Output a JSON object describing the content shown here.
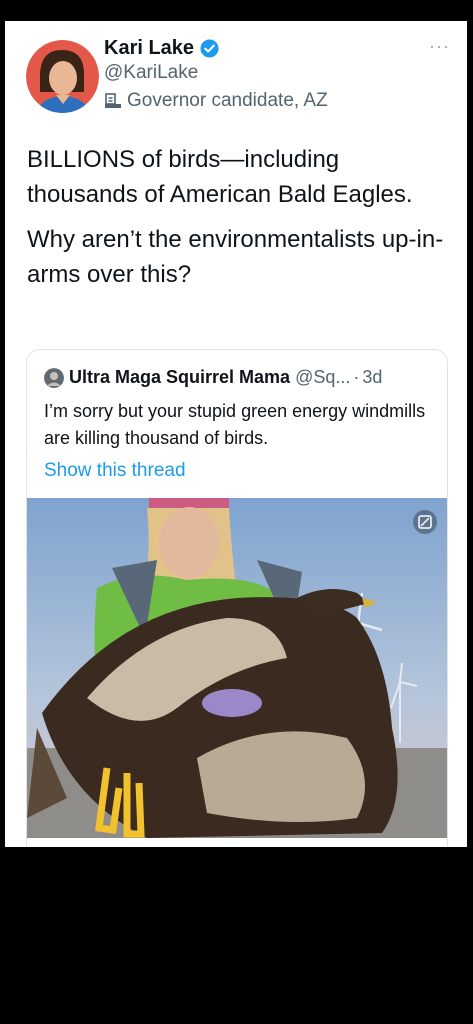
{
  "tweet": {
    "author_name": "Kari Lake",
    "author_handle": "@KariLake",
    "author_label": "Governor candidate, AZ",
    "more_icon": "more-horizontal-icon",
    "text_paragraphs": [
      "BILLIONS of birds—including thousands of American Bald Eagles.",
      "Why aren’t the environmentalists up-in-arms over this?"
    ]
  },
  "quote": {
    "author_name": "Ultra Maga Squirrel Mama",
    "author_handle": "@Sq...",
    "separator": "·",
    "time": "3d",
    "text": "I’m sorry but your stupid green energy windmills are killing thousand of birds.",
    "link_label": "Show this thread"
  },
  "colors": {
    "link": "#1d9bf0",
    "secondary_text": "#536471",
    "verified": "#1d9bf0"
  }
}
